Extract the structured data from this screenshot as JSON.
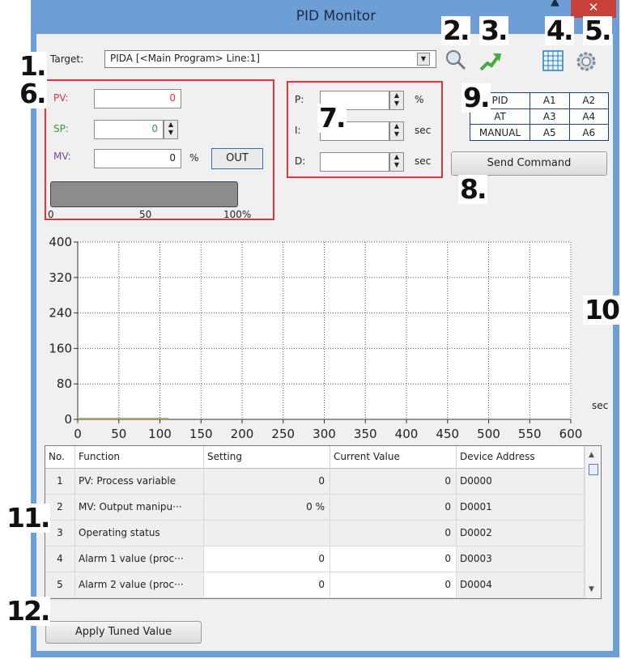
{
  "window": {
    "title": "PID Monitor",
    "close": "✕"
  },
  "numbers": {
    "n1": "1.",
    "n2": "2.",
    "n3": "3.",
    "n4": "4.",
    "n5": "5.",
    "n6": "6.",
    "n7": "7.",
    "n8": "8.",
    "n9": "9.",
    "n10": "10.",
    "n11": "11.",
    "n12": "12."
  },
  "target": {
    "label": "Target:",
    "value": "PIDA [<Main Program> Line:1]"
  },
  "monitor": {
    "pv_label": "PV:",
    "pv_value": "0",
    "pv_color": "#e0343b",
    "sp_label": "SP:",
    "sp_value": "0",
    "sp_color": "#2f9a3c",
    "mv_label": "MV:",
    "mv_value": "0",
    "mv_unit": "%",
    "mv_color": "#7b3fa0",
    "out_label": "OUT",
    "bar_ticks": [
      "0",
      "50",
      "100%"
    ],
    "bar_level": 0
  },
  "params": {
    "p_label": "P:",
    "p_unit": "%",
    "i_label": "I:",
    "i_unit": "sec",
    "d_label": "D:",
    "d_unit": "sec"
  },
  "mode_table": [
    [
      "PID",
      "A1",
      "A2"
    ],
    [
      "AT",
      "A3",
      "A4"
    ],
    [
      "MANUAL",
      "A5",
      "A6"
    ]
  ],
  "send_command": "Send Command",
  "chart_data": {
    "type": "line",
    "x_ticks": [
      "0",
      "50",
      "100",
      "150",
      "200",
      "250",
      "300",
      "350",
      "400",
      "450",
      "500",
      "550",
      "600"
    ],
    "y_ticks": [
      "400",
      "320",
      "240",
      "160",
      "80",
      "0"
    ],
    "xlabel": "sec",
    "xlim": [
      0,
      600
    ],
    "ylim": [
      0,
      400
    ],
    "grid": true,
    "series": [
      {
        "color": "#b8a860",
        "x": [
          0,
          110
        ],
        "values": [
          0,
          0
        ]
      }
    ]
  },
  "table": {
    "headers": [
      "No.",
      "Function",
      "Setting",
      "Current Value",
      "Device Address"
    ],
    "rows": [
      {
        "no": "1",
        "function": "PV: Process variable",
        "setting": "0",
        "current": "0",
        "address": "D0000"
      },
      {
        "no": "2",
        "function": "MV: Output manipu···",
        "setting": "0 %",
        "current": "0",
        "address": "D0001"
      },
      {
        "no": "3",
        "function": "Operating status",
        "setting": "",
        "current": "0",
        "address": "D0002"
      },
      {
        "no": "4",
        "function": "Alarm 1 value (proc···",
        "setting": "0",
        "current": "0",
        "address": "D0003"
      },
      {
        "no": "5",
        "function": "Alarm 2 value (proc···",
        "setting": "0",
        "current": "0",
        "address": "D0004"
      }
    ]
  },
  "apply_button": "Apply Tuned Value",
  "icons": {
    "search": "search-icon",
    "trend": "trend-arrow-icon",
    "grid": "grid-icon",
    "settings": "gear-icon"
  }
}
